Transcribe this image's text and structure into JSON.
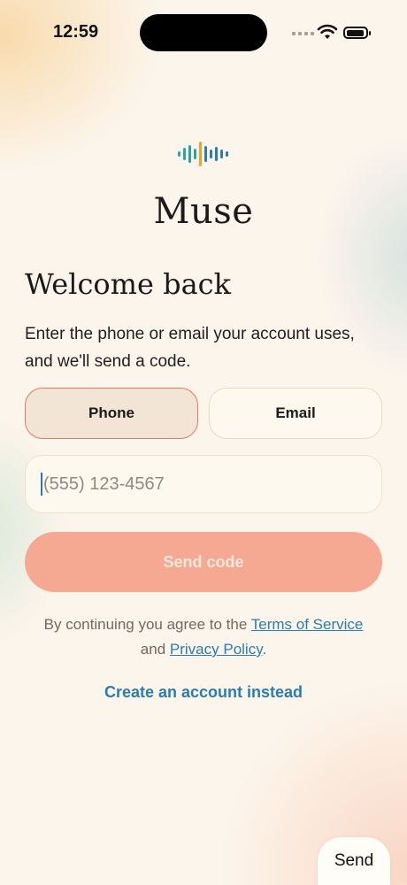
{
  "status_bar": {
    "time": "12:59"
  },
  "app": {
    "name": "Muse",
    "logo_icon": "waveform-icon"
  },
  "heading": "Welcome back",
  "subtitle": "Enter the phone or email your account uses, and we'll send a code.",
  "tabs": [
    {
      "label": "Phone",
      "selected": true
    },
    {
      "label": "Email",
      "selected": false
    }
  ],
  "phone_input": {
    "value": "",
    "placeholder": "(555) 123-4567"
  },
  "send_button": {
    "label": "Send code",
    "enabled": false
  },
  "legal": {
    "prefix": "By continuing you agree to the",
    "terms_link": "Terms of Service",
    "middle": "and",
    "privacy_link": "Privacy Policy",
    "suffix": "."
  },
  "create_account_link": "Create an account instead",
  "keyboard": {
    "send_key": "Send"
  },
  "colors": {
    "accent": "#f5a992",
    "selected_border": "#e8795a",
    "link": "#2a7cb3",
    "background": "#fcf5ec"
  }
}
